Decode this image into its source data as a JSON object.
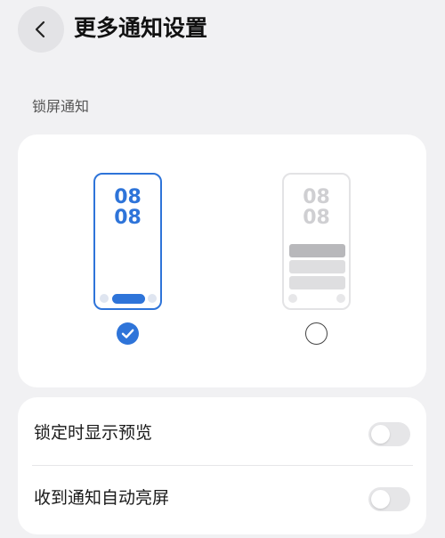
{
  "header": {
    "title": "更多通知设置",
    "back_icon": "chevron-left-icon"
  },
  "lock_screen": {
    "section_label": "锁屏通知",
    "styles": [
      {
        "clock_hour": "08",
        "clock_minute": "08",
        "selected": true
      },
      {
        "clock_hour": "08",
        "clock_minute": "08",
        "selected": false
      }
    ],
    "accent_color": "#2e74d9"
  },
  "options": [
    {
      "label": "锁定时显示预览",
      "enabled": false
    },
    {
      "label": "收到通知自动亮屏",
      "enabled": false
    }
  ]
}
